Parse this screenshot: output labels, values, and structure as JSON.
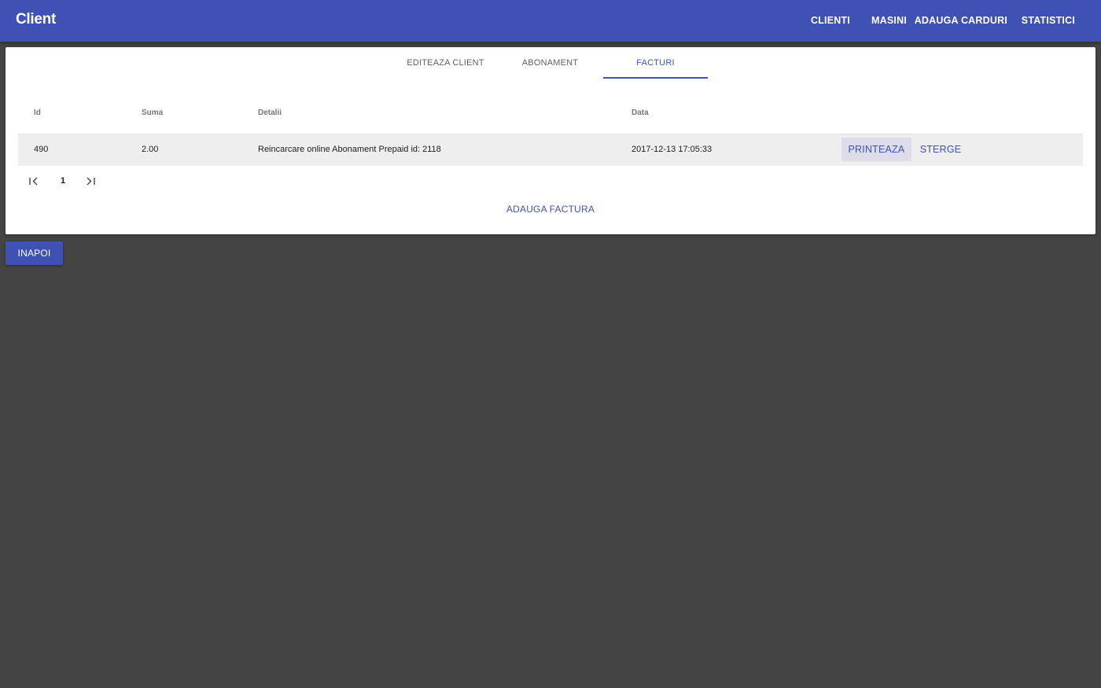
{
  "app": {
    "title": "Client"
  },
  "nav": {
    "items": [
      {
        "label": "CLIENTI"
      },
      {
        "label": "MASINI"
      },
      {
        "label": "ADAUGA CARDURI"
      },
      {
        "label": "STATISTICI"
      }
    ]
  },
  "tabs": {
    "items": [
      {
        "label": "EDITEAZA CLIENT"
      },
      {
        "label": "ABONAMENT"
      },
      {
        "label": "FACTURI"
      }
    ],
    "active": "FACTURI"
  },
  "table": {
    "columns": [
      "Id",
      "Suma",
      "Detalii",
      "Data"
    ],
    "rows": [
      {
        "id": "490",
        "suma": "2.00",
        "detalii": "Reincarcare online Abonament Prepaid id: 2118",
        "data": "2017-12-13 17:05:33",
        "print_label": "PRINTEAZA",
        "delete_label": "STERGE"
      }
    ]
  },
  "pagination": {
    "current_page": "1",
    "first_icon": "first-page-icon",
    "last_icon": "last-page-icon"
  },
  "actions": {
    "add_invoice_label": "ADAUGA FACTURA",
    "back_label": "INAPOI"
  },
  "colors": {
    "primary": "#3f51b5",
    "background": "#444444",
    "row_highlight": "#eeeeee"
  }
}
